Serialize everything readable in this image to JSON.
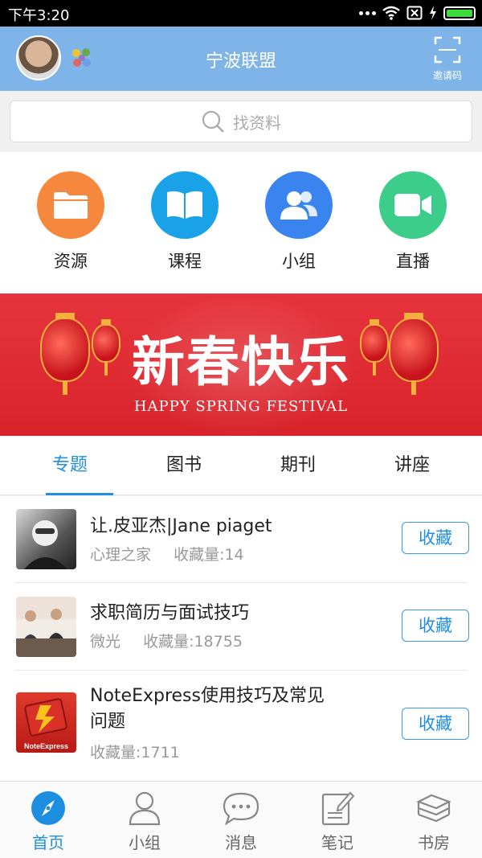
{
  "status_bar": {
    "time": "下午3:20"
  },
  "header": {
    "title": "宁波联盟",
    "invite_label": "邀请码"
  },
  "search": {
    "placeholder": "找资料"
  },
  "quick_actions": [
    {
      "label": "资源",
      "icon": "folder-icon",
      "color": "#f5883c"
    },
    {
      "label": "课程",
      "icon": "book-icon",
      "color": "#1aa2e8"
    },
    {
      "label": "小组",
      "icon": "group-icon",
      "color": "#3a84f0"
    },
    {
      "label": "直播",
      "icon": "video-camera-icon",
      "color": "#3ccd8a"
    }
  ],
  "banner": {
    "headline": "新春快乐",
    "subtitle": "HAPPY SPRING FESTIVAL"
  },
  "tabs": [
    {
      "label": "专题",
      "active": true
    },
    {
      "label": "图书",
      "active": false
    },
    {
      "label": "期刊",
      "active": false
    },
    {
      "label": "讲座",
      "active": false
    }
  ],
  "items": [
    {
      "title": "让.皮亚杰|Jane piaget",
      "source": "心理之家",
      "favorites": "收藏量:14",
      "action": "收藏"
    },
    {
      "title": "求职简历与面试技巧",
      "source": "微光",
      "favorites": "收藏量:18755",
      "action": "收藏"
    },
    {
      "title": "NoteExpress使用技巧及常见问题",
      "source": "",
      "favorites": "收藏量:1711",
      "action": "收藏",
      "thumb_text": "NoteExpress"
    }
  ],
  "bottom_nav": [
    {
      "label": "首页",
      "icon": "compass-icon",
      "active": true
    },
    {
      "label": "小组",
      "icon": "person-icon",
      "active": false
    },
    {
      "label": "消息",
      "icon": "chat-bubble-icon",
      "active": false
    },
    {
      "label": "笔记",
      "icon": "note-edit-icon",
      "active": false
    },
    {
      "label": "书房",
      "icon": "stacked-books-icon",
      "active": false
    }
  ],
  "colors": {
    "header": "#7fb4e8",
    "accent": "#1e8fe0",
    "banner": "#e7343c"
  }
}
